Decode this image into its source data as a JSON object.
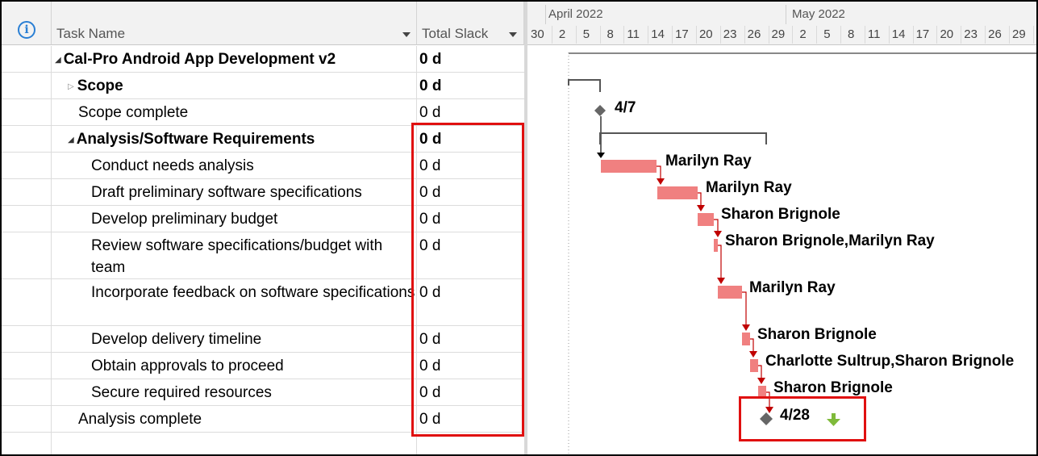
{
  "header": {
    "info_icon": "info-icon",
    "task_name_label": "Task Name",
    "total_slack_label": "Total Slack"
  },
  "timescale": {
    "months": [
      "April 2022",
      "May 2022"
    ],
    "days": [
      "30",
      "2",
      "5",
      "8",
      "11",
      "14",
      "17",
      "20",
      "23",
      "26",
      "29",
      "2",
      "5",
      "8",
      "11",
      "14",
      "17",
      "20",
      "23",
      "26",
      "29"
    ]
  },
  "tasks": [
    {
      "name": "Cal-Pro Android App Development v2",
      "slack": "0 d",
      "bold": true,
      "indent": 0,
      "expander": "open"
    },
    {
      "name": "Scope",
      "slack": "0 d",
      "bold": true,
      "indent": 1,
      "expander": "closed"
    },
    {
      "name": "Scope complete",
      "slack": "0 d",
      "bold": false,
      "indent": 1,
      "expander": "none"
    },
    {
      "name": "Analysis/Software Requirements",
      "slack": "0 d",
      "bold": true,
      "indent": 1,
      "expander": "open"
    },
    {
      "name": "Conduct needs analysis",
      "slack": "0 d",
      "bold": false,
      "indent": 2,
      "expander": "none"
    },
    {
      "name": "Draft preliminary software specifications",
      "slack": "0 d",
      "bold": false,
      "indent": 2,
      "expander": "none"
    },
    {
      "name": "Develop preliminary budget",
      "slack": "0 d",
      "bold": false,
      "indent": 2,
      "expander": "none"
    },
    {
      "name": "Review software specifications/budget with team",
      "slack": "0 d",
      "bold": false,
      "indent": 2,
      "expander": "none"
    },
    {
      "name": "Incorporate feedback on software specifications",
      "slack": "0 d",
      "bold": false,
      "indent": 2,
      "expander": "none"
    },
    {
      "name": "Develop delivery timeline",
      "slack": "0 d",
      "bold": false,
      "indent": 2,
      "expander": "none"
    },
    {
      "name": "Obtain approvals to proceed",
      "slack": "0 d",
      "bold": false,
      "indent": 2,
      "expander": "none"
    },
    {
      "name": "Secure required resources",
      "slack": "0 d",
      "bold": false,
      "indent": 2,
      "expander": "none"
    },
    {
      "name": "Analysis complete",
      "slack": "0 d",
      "bold": false,
      "indent": 1,
      "expander": "none"
    }
  ],
  "gantt_labels": {
    "scope_milestone": "4/7",
    "bar1": "Marilyn Ray",
    "bar2": "Marilyn Ray",
    "bar3": "Sharon Brignole",
    "bar4": "Sharon Brignole,Marilyn Ray",
    "bar5": "Marilyn Ray",
    "bar6": "Sharon Brignole",
    "bar7": "Charlotte Sultrup,Sharon Brignole",
    "bar8": "Sharon Brignole",
    "analysis_milestone": "4/28"
  },
  "colors": {
    "critical_bar": "#f08080",
    "link_arrow": "#c00000",
    "highlight": "#e01010",
    "milestone": "#555555",
    "down_arrow": "#7fba3a"
  }
}
